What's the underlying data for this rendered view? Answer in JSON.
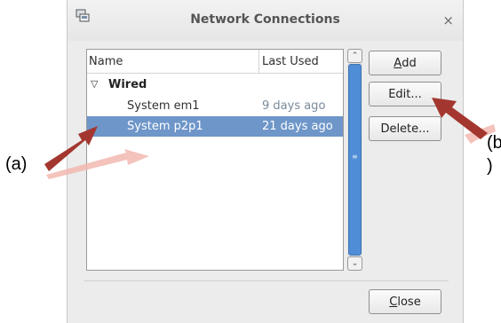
{
  "window": {
    "title": "Network Connections",
    "close_glyph": "×",
    "app_icon": "network-connections-icon"
  },
  "list": {
    "columns": {
      "name": "Name",
      "last_used": "Last Used"
    },
    "group": {
      "toggle_glyph": "▽",
      "label": "Wired"
    },
    "rows": [
      {
        "name": "System em1",
        "last_used": "9 days ago",
        "selected": false
      },
      {
        "name": "System p2p1",
        "last_used": "21 days ago",
        "selected": true
      }
    ]
  },
  "scrollbar": {
    "up_glyph": "⌃",
    "down_glyph": "⌄",
    "grip_glyph": "≡"
  },
  "buttons": {
    "add": {
      "mnemonic": "A",
      "rest": "dd"
    },
    "edit": "Edit...",
    "delete": "Delete...",
    "close": {
      "mnemonic": "C",
      "rest": "lose"
    }
  },
  "annotations": {
    "a": "(a)",
    "b_line1": "(b",
    "b_line2": ")"
  },
  "colors": {
    "selection": "#6e96c9",
    "scroll_thumb": "#4f8ed6",
    "arrow_dark": "#a3372f",
    "arrow_light": "#f2b8b0"
  }
}
